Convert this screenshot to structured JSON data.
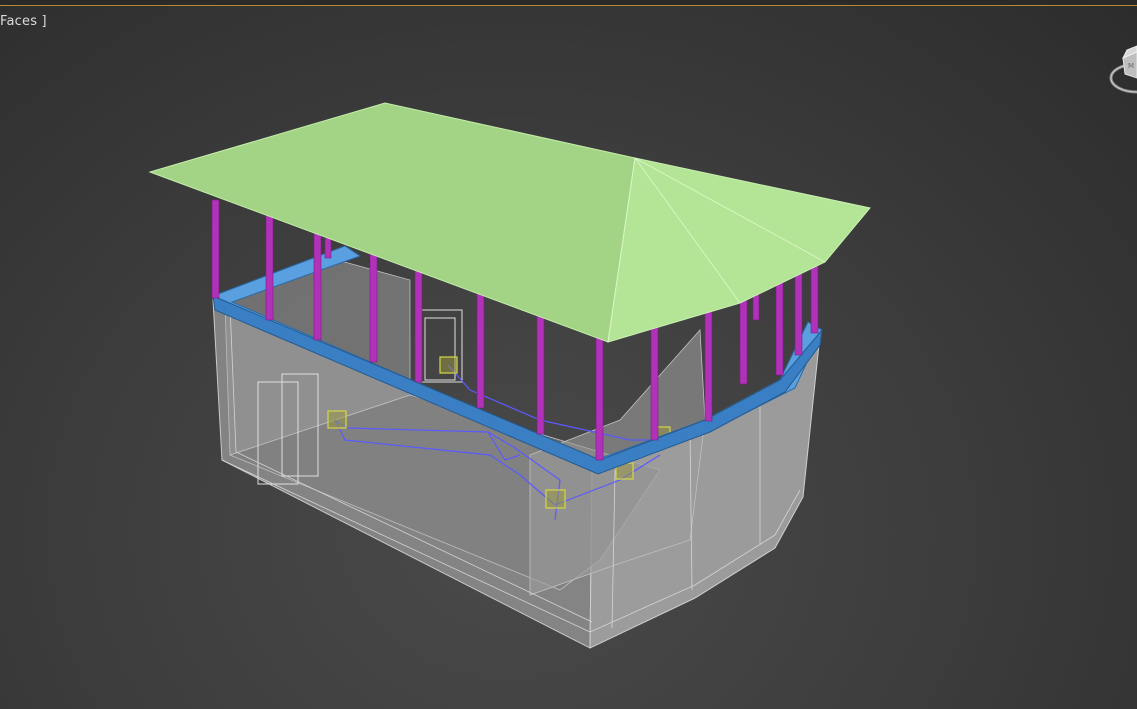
{
  "viewport": {
    "label": "Faces ]"
  },
  "colors": {
    "roof": "#a7d98c",
    "columns": "#b032b8",
    "beam": "#3f86c9",
    "walls": "#a9a9a9",
    "selection_wire": "#5a5aff",
    "helpers": "#b8b840"
  },
  "icons": {
    "viewcube": "viewcube-icon"
  }
}
